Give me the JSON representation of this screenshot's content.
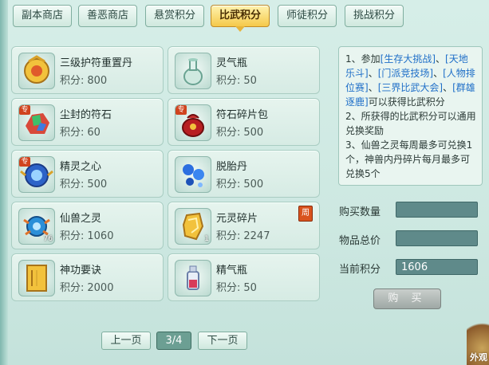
{
  "tabs": [
    {
      "label": "副本商店",
      "active": false
    },
    {
      "label": "善恶商店",
      "active": false
    },
    {
      "label": "悬赏积分",
      "active": false
    },
    {
      "label": "比武积分",
      "active": true
    },
    {
      "label": "师徒积分",
      "active": false
    },
    {
      "label": "挑战积分",
      "active": false
    }
  ],
  "score_label": "积分:",
  "items": [
    {
      "name": "三级护符重置丹",
      "score": "800",
      "icon": "amulet-pill-icon"
    },
    {
      "name": "灵气瓶",
      "score": "50",
      "icon": "spirit-vase-icon"
    },
    {
      "name": "尘封的符石",
      "score": "60",
      "icon": "rune-stone-icon",
      "tag": "专"
    },
    {
      "name": "符石碎片包",
      "score": "500",
      "icon": "rune-fragment-bag-icon",
      "tag": "专"
    },
    {
      "name": "精灵之心",
      "score": "500",
      "icon": "spirit-heart-icon",
      "tag": "专"
    },
    {
      "name": "脱胎丹",
      "score": "500",
      "icon": "rebirth-pill-icon"
    },
    {
      "name": "仙兽之灵",
      "score": "1060",
      "icon": "beast-spirit-icon",
      "qty": "76"
    },
    {
      "name": "元灵碎片",
      "score": "2247",
      "icon": "yuanling-fragment-icon",
      "qty": "1",
      "badge": "周"
    },
    {
      "name": "神功要诀",
      "score": "2000",
      "icon": "skill-book-icon"
    },
    {
      "name": "精气瓶",
      "score": "50",
      "icon": "essence-bottle-icon"
    }
  ],
  "info": {
    "p1_prefix": "1、参加",
    "act1": "[生存大挑战]",
    "sep": "、",
    "act2": "[天地乐斗]",
    "act3": "[门派竞技场]",
    "act4": "[人物排位赛]",
    "act5": "[三界比武大会]",
    "act6": "[群雄逐鹿]",
    "p1_suffix": "可以获得比武积分",
    "p2": "2、所获得的比武积分可以通用兑换奖励",
    "p3": "3、仙兽之灵每周最多可兑换1个，神兽内丹碎片每月最多可兑换5个"
  },
  "buy_qty_label": "购买数量",
  "buy_qty_value": "",
  "total_price_label": "物品总价",
  "total_price_value": "",
  "current_score_label": "当前积分",
  "current_score_value": "1606",
  "buy_button": "购 买",
  "pager": {
    "prev": "上一页",
    "page": "3/4",
    "next": "下一页"
  },
  "corner_text": "外观",
  "colors": {
    "active_tab": "#f5c94a",
    "link_blue": "#1f6fc8",
    "field_bg": "#5f8a8a"
  }
}
